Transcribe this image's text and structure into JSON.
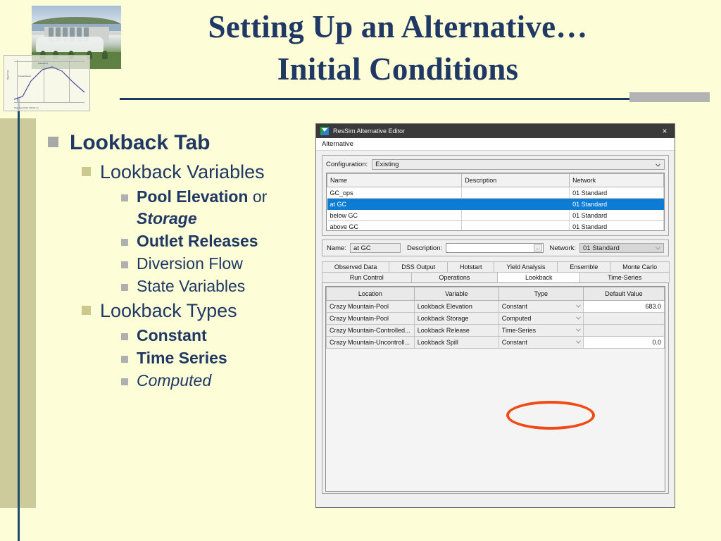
{
  "slide": {
    "title_line1": "Setting Up an Alternative…",
    "title_line2": "Initial Conditions",
    "accent_navy": "#1f3864",
    "background": "#fdfdd8",
    "olive": "#cdcb9b"
  },
  "images": {
    "dam_photo_alt": "dam-spillway-photo",
    "chart_overlay_alt": "stage-hydrograph-chart",
    "chart_overlay_labels": {
      "ylabel": "Stage in feet",
      "annotation_peak": "Peak Record",
      "annotation_forecast": "Forecast Record",
      "footer": "Stage (feet) 1100.4 ft NGVD vert"
    }
  },
  "bullets": [
    {
      "level": 1,
      "text": "Lookback Tab",
      "style": "bold",
      "marker": "gray"
    },
    {
      "level": 2,
      "text": "Lookback Variables",
      "style": "regular",
      "marker": "khaki"
    },
    {
      "level": 3,
      "text": "Pool Elevation or Storage",
      "style": "mixed",
      "marker": "gray",
      "parts": [
        {
          "text": "Pool Elevation",
          "style": "bold"
        },
        {
          "text": " or ",
          "style": "regular"
        },
        {
          "text": "Storage",
          "style": "bold-italic"
        }
      ]
    },
    {
      "level": 3,
      "text": "Outlet Releases",
      "style": "bold",
      "marker": "gray"
    },
    {
      "level": 3,
      "text": "Diversion Flow",
      "style": "regular",
      "marker": "gray"
    },
    {
      "level": 3,
      "text": "State Variables",
      "style": "regular",
      "marker": "gray"
    },
    {
      "level": 2,
      "text": "Lookback Types",
      "style": "regular",
      "marker": "khaki"
    },
    {
      "level": 3,
      "text": "Constant",
      "style": "bold",
      "marker": "gray"
    },
    {
      "level": 3,
      "text": "Time Series",
      "style": "bold",
      "marker": "gray"
    },
    {
      "level": 3,
      "text": "Computed",
      "style": "italic",
      "marker": "gray"
    }
  ],
  "bullet_text": {
    "b0": "Lookback Tab",
    "b1": "Lookback Variables",
    "b2a": "Pool Elevation",
    "b2b": " or ",
    "b2c": "Storage",
    "b3": "Outlet Releases",
    "b4": "Diversion Flow",
    "b5": "State Variables",
    "b6": "Lookback Types",
    "b7": "Constant",
    "b8": "Time Series",
    "b9": "Computed"
  },
  "dialog": {
    "title": "ResSim Alternative Editor",
    "close_label": "×",
    "menu": {
      "alternative": "Alternative"
    },
    "configuration": {
      "label": "Configuration:",
      "value": "Existing"
    },
    "alt_table": {
      "columns": [
        "Name",
        "Description",
        "Network"
      ],
      "rows": [
        {
          "name": "GC_ops",
          "description": "",
          "network": "01 Standard",
          "selected": false
        },
        {
          "name": "at GC",
          "description": "",
          "network": "01 Standard",
          "selected": true
        },
        {
          "name": "below GC",
          "description": "",
          "network": "01 Standard",
          "selected": false
        },
        {
          "name": "above GC",
          "description": "",
          "network": "01 Standard",
          "selected": false
        }
      ]
    },
    "detail": {
      "name_label": "Name:",
      "name_value": "at GC",
      "description_label": "Description:",
      "description_value": "",
      "description_button": "...",
      "network_label": "Network:",
      "network_value": "01 Standard"
    },
    "tabs_row1": [
      "Observed Data",
      "DSS Output",
      "Hotstart",
      "Yield Analysis",
      "Ensemble",
      "Monte Carlo"
    ],
    "tabs_row2": [
      "Run Control",
      "Operations",
      "Lookback",
      "Time-Series"
    ],
    "selected_tab": "Lookback",
    "lookback_table": {
      "columns": [
        "Location",
        "Variable",
        "Type",
        "Default Value"
      ],
      "rows": [
        {
          "location": "Crazy Mountain-Pool",
          "variable": "Lookback Elevation",
          "type": "Constant",
          "default_value": "683.0"
        },
        {
          "location": "Crazy Mountain-Pool",
          "variable": "Lookback Storage",
          "type": "Computed",
          "default_value": ""
        },
        {
          "location": "Crazy Mountain-Controlled...",
          "variable": "Lookback Release",
          "type": "Time-Series",
          "default_value": ""
        },
        {
          "location": "Crazy Mountain-Uncontroll...",
          "variable": "Lookback Spill",
          "type": "Constant",
          "default_value": "0.0"
        }
      ]
    },
    "highlight_color": "#f04b16",
    "selection_color": "#0c7cd5"
  }
}
